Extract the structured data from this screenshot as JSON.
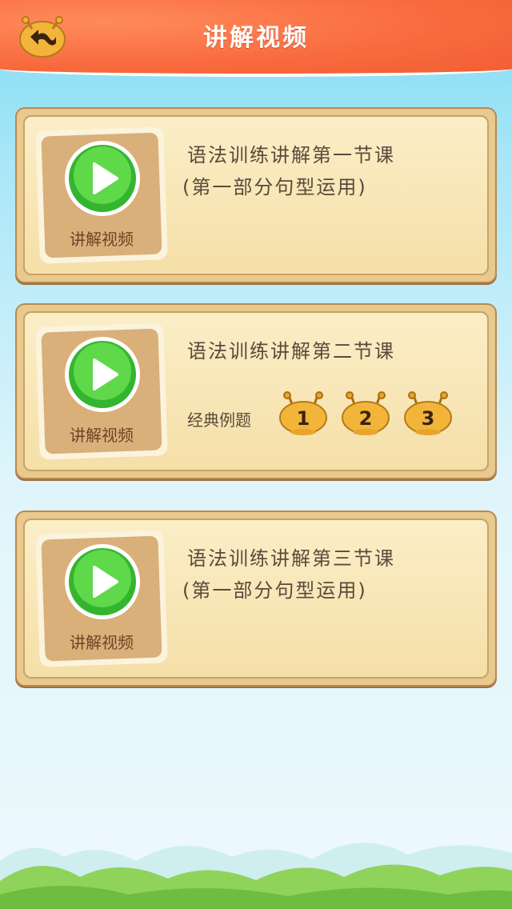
{
  "header": {
    "title": "讲解视频",
    "back_icon": "back-arrow-icon"
  },
  "cards": [
    {
      "tile_label": "讲解视频",
      "line1": "语法训练讲解第一节课",
      "line2": "(第一部分句型运用)"
    },
    {
      "tile_label": "讲解视频",
      "line1": "语法训练讲解第二节课",
      "examples_label": "经典例题",
      "examples": [
        "1",
        "2",
        "3"
      ]
    },
    {
      "tile_label": "讲解视频",
      "line1": "语法训练讲解第三节课",
      "line2": "(第一部分句型运用)"
    }
  ],
  "colors": {
    "header": "#f86a3d",
    "play": "#3cc23a",
    "card": "#f5dfa8"
  }
}
